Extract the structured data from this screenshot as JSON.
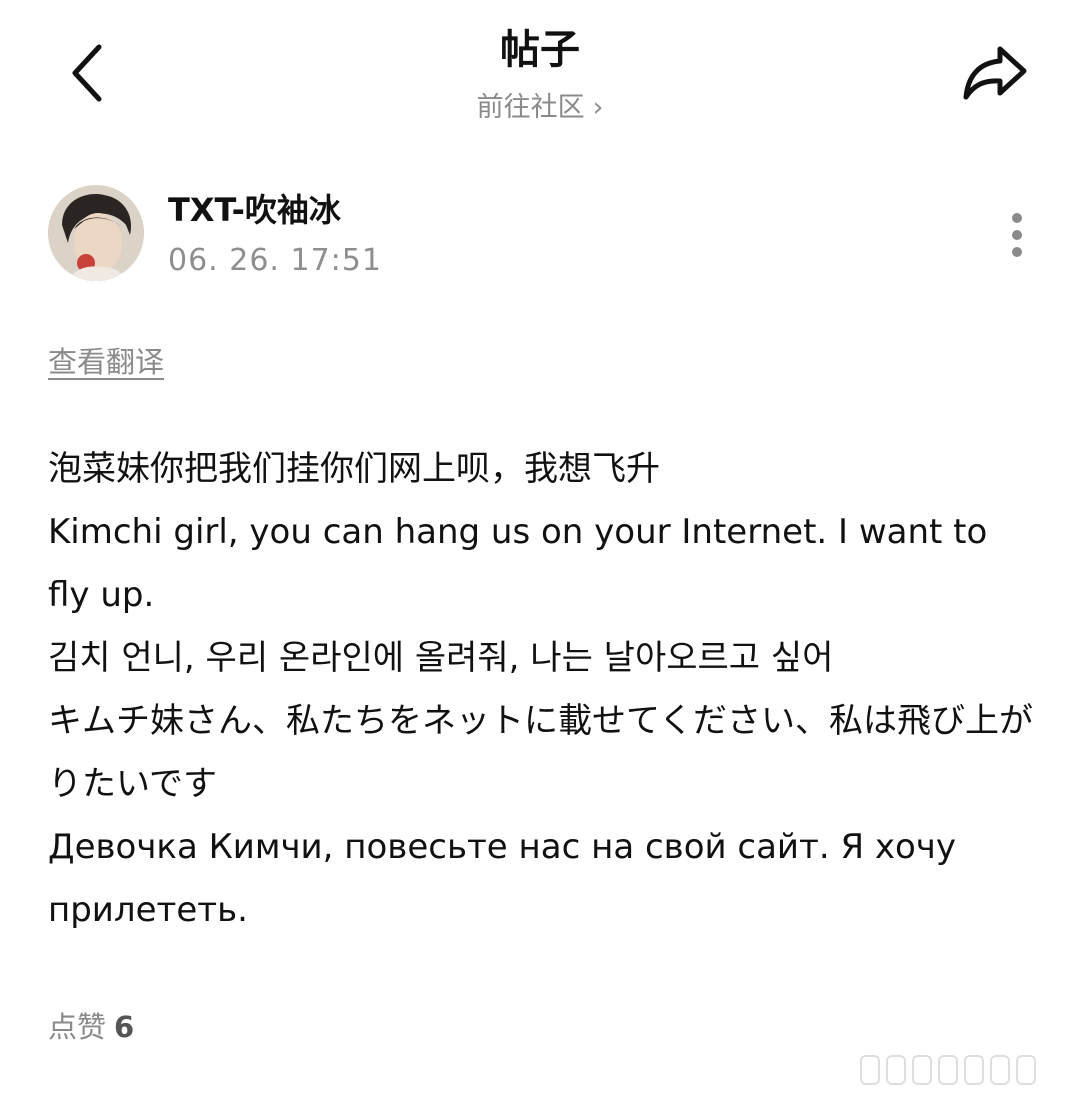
{
  "header": {
    "title": "帖子",
    "community_link": "前往社区",
    "back_icon": "chevron-left-icon",
    "share_icon": "share-arrow-icon"
  },
  "post": {
    "author": "TXT-吹袖冰",
    "timestamp": "06. 26. 17:51",
    "translate_label": "查看翻译",
    "body": [
      "泡菜妹你把我们挂你们网上呗，我想飞升",
      "Kimchi girl, you can hang us on your Internet. I want to fly up.",
      "김치 언니, 우리 온라인에 올려줘, 나는 날아오르고 싶어",
      "キムチ妹さん、私たちをネットに載せてください、私は飛び上がりたいです",
      "Девочка Кимчи, повесьте нас на свой сайт. Я хочу прилететь."
    ],
    "likes_label": "点赞",
    "likes_count": "6"
  },
  "colors": {
    "text": "#111111",
    "muted": "#8a8a8a",
    "background": "#ffffff"
  }
}
